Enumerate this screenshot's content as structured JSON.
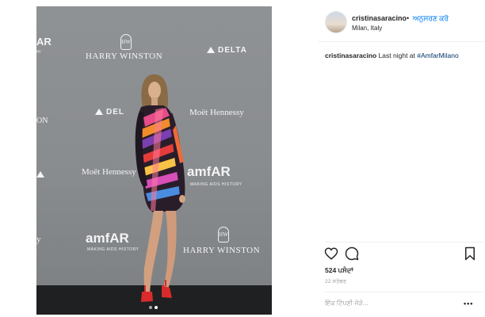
{
  "post": {
    "username": "cristinasaracino",
    "separator": "•",
    "follow_label": "ਅਨੁਸਰਣ ਕਰੋ",
    "location": "Milan, Italy",
    "caption_user": "cristinasaracino",
    "caption_text": " Last night at ",
    "caption_tag": "#AmfarMilano",
    "likes": "524 ਪਸੰਦਾਂ",
    "date": "22 ਸਤੰਬਰ",
    "comment_placeholder": "ਇੱਕ ਟਿੱਪਣੀ ਜੋੜੋ...",
    "more_label": "•••"
  },
  "photo": {
    "sponsors": {
      "harry_winston": "HARRY WINSTON",
      "delta": "DELTA",
      "moet": "Moët Hennessy",
      "amfar": "amfAR",
      "amfar_sub": "MAKING AIDS HISTORY",
      "hw_mark": "HW",
      "cut_ar": "AR",
      "cut_on": "ON",
      "cut_y": "y",
      "cut_delta": "DEL"
    },
    "carousel": {
      "count": 2,
      "active": 1
    }
  },
  "icons": [
    "heart-icon",
    "comment-icon",
    "bookmark-icon",
    "delta-icon",
    "harry-winston-icon"
  ],
  "colors": {
    "link": "#3897f0",
    "hashtag": "#003569",
    "muted": "#999999",
    "text": "#262626"
  }
}
